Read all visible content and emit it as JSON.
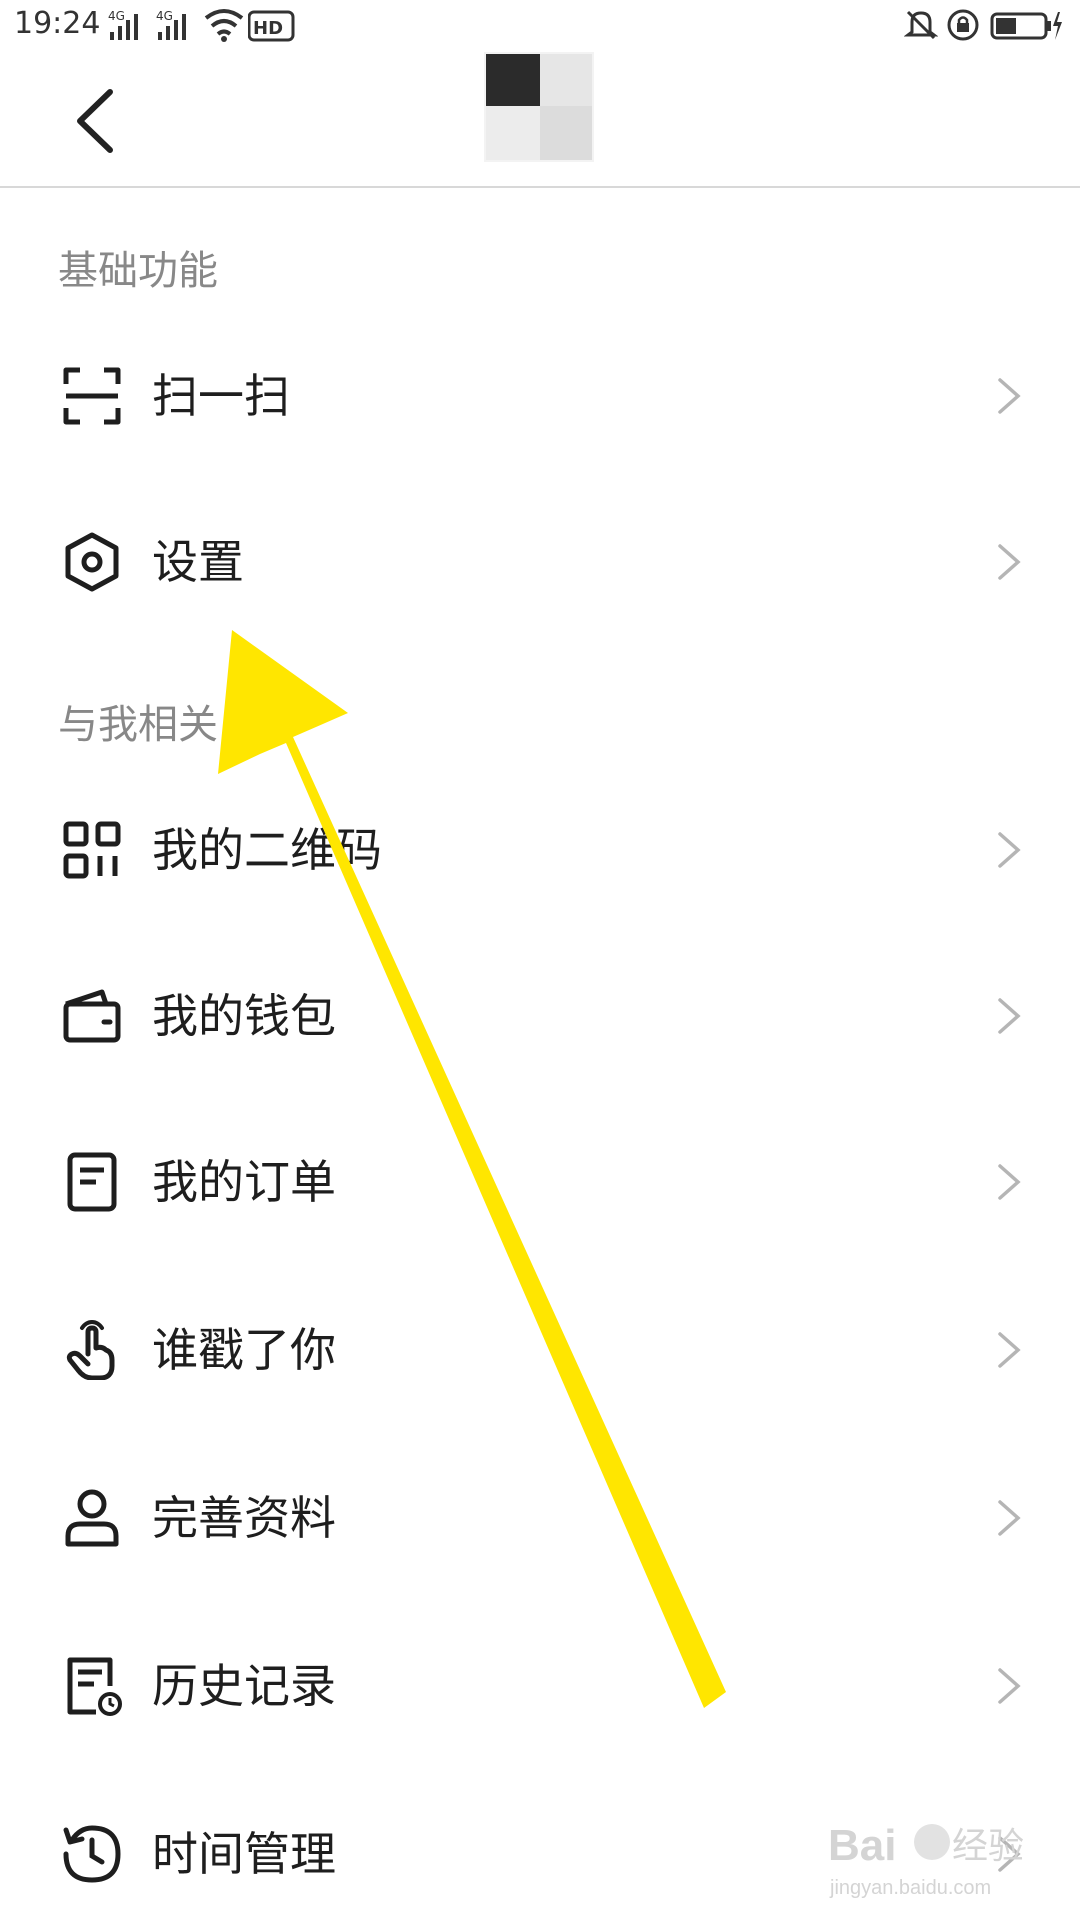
{
  "status_bar": {
    "time": "19:24",
    "icons": [
      "signal-4g-icon",
      "signal-4g-icon",
      "wifi-icon",
      "hd-icon",
      "mute-icon",
      "lock-icon",
      "battery-charging-icon"
    ]
  },
  "header": {
    "back_icon": "chevron-left-icon"
  },
  "sections": [
    {
      "title": "基础功能",
      "items": [
        {
          "label": "扫一扫",
          "icon": "scan-icon"
        },
        {
          "label": "设置",
          "icon": "settings-hexagon-icon"
        }
      ]
    },
    {
      "title": "与我相关",
      "items": [
        {
          "label": "我的二维码",
          "icon": "qr-code-icon"
        },
        {
          "label": "我的钱包",
          "icon": "wallet-icon"
        },
        {
          "label": "我的订单",
          "icon": "order-icon"
        },
        {
          "label": "谁戳了你",
          "icon": "finger-poke-icon"
        },
        {
          "label": "完善资料",
          "icon": "profile-icon"
        },
        {
          "label": "历史记录",
          "icon": "history-doc-icon"
        },
        {
          "label": "时间管理",
          "icon": "clock-history-icon"
        }
      ]
    }
  ],
  "watermark": {
    "brand": "Bai",
    "brand_suffix": "经验",
    "url": "jingyan.baidu.com"
  },
  "colors": {
    "annotation_arrow": "#FFE600",
    "section_header": "#888888",
    "divider": "#D8D8D8"
  }
}
